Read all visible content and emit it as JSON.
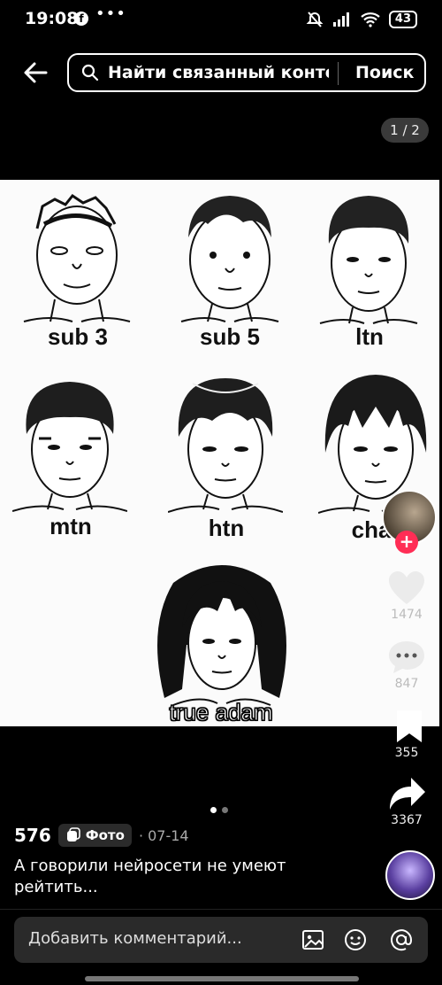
{
  "status_bar": {
    "time": "19:08",
    "dots": "•••",
    "battery": "43"
  },
  "search": {
    "placeholder": "Найти связанный конте...",
    "button": "Поиск"
  },
  "page_indicator": "1 / 2",
  "photo": {
    "labels": [
      "sub 3",
      "sub 5",
      "ltn",
      "mtn",
      "htn",
      "chad",
      "true adam"
    ]
  },
  "rail": {
    "likes": "1474",
    "comments": "847",
    "saves": "355",
    "shares": "3367"
  },
  "post": {
    "count": "576",
    "badge": "Фото",
    "date": "· 07-14",
    "caption": "А говорили нейросети не умеют рейтить..."
  },
  "comment_bar": {
    "placeholder": "Добавить комментарий..."
  },
  "icons": [
    "back-arrow-icon",
    "search-icon",
    "heart-icon",
    "comment-icon",
    "bookmark-icon",
    "share-icon",
    "image-icon",
    "emoji-icon",
    "at-icon"
  ]
}
